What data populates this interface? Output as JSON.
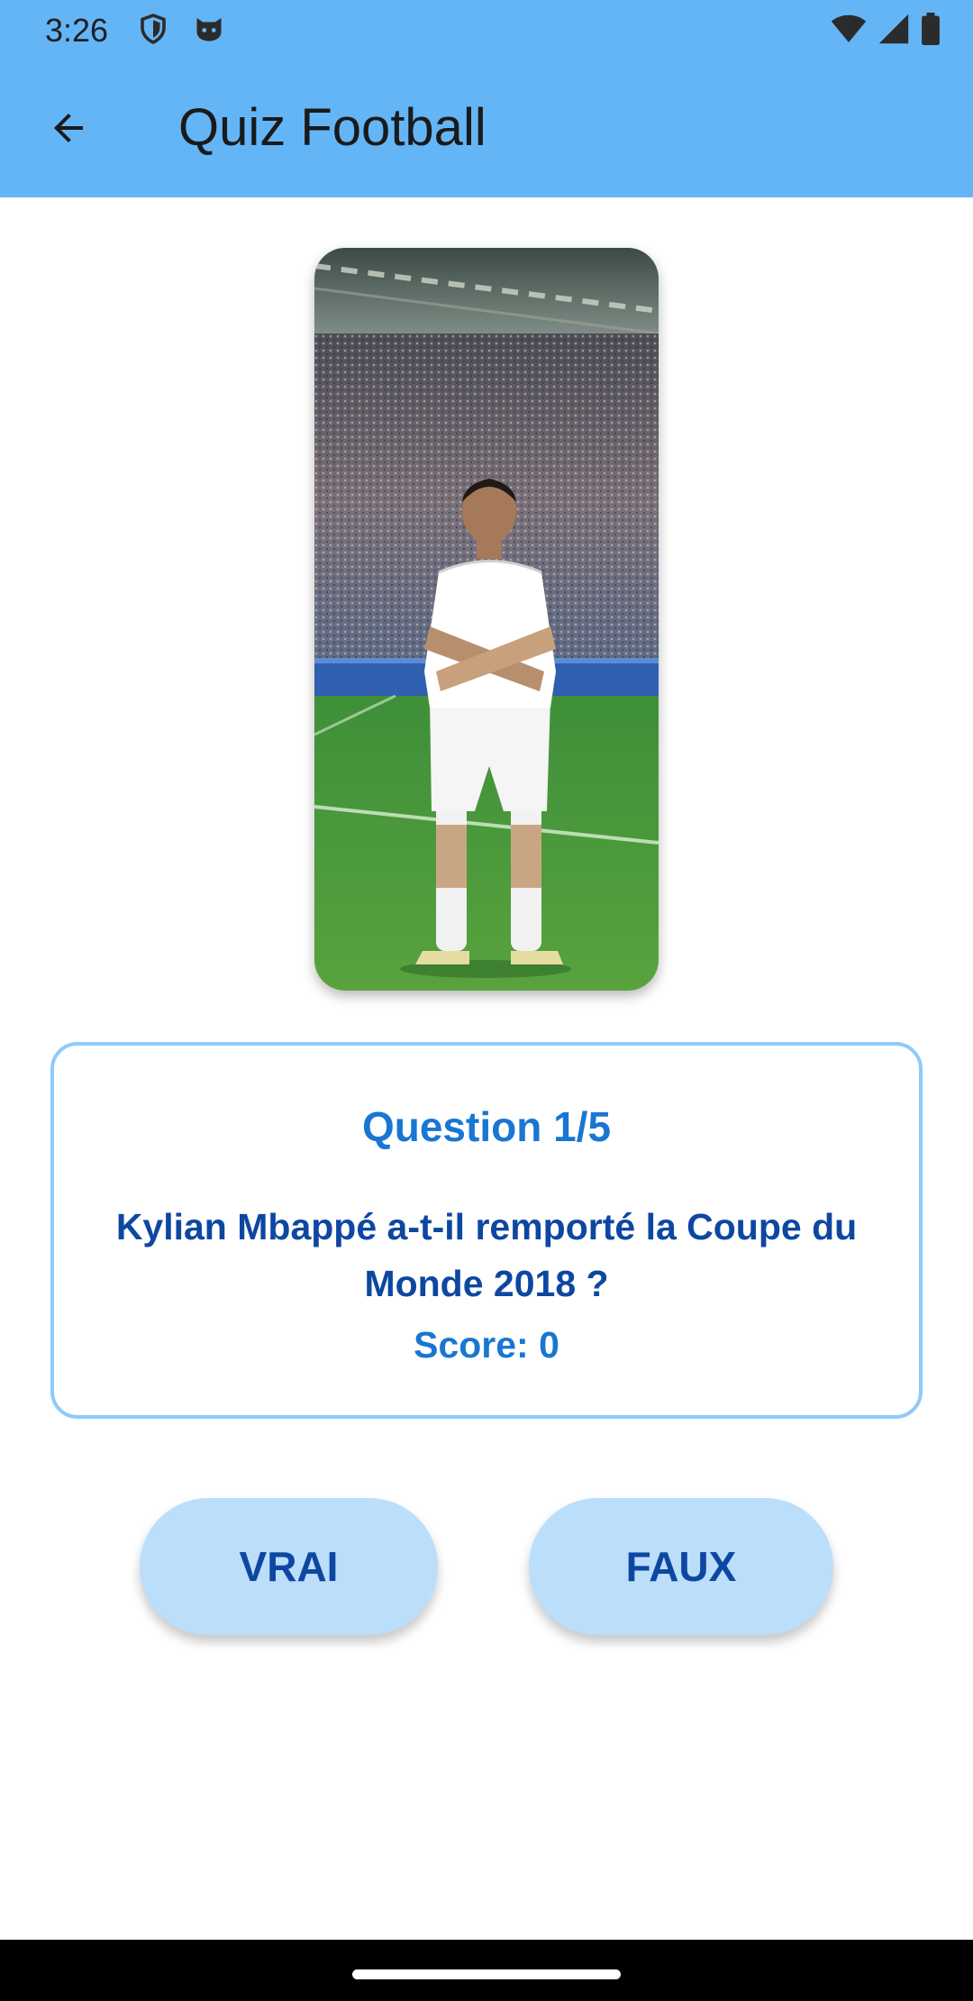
{
  "status_bar": {
    "time": "3:26",
    "left_icons": [
      "shield-icon",
      "cat-face-icon"
    ],
    "right_icons": [
      "wifi-icon",
      "signal-icon",
      "battery-icon"
    ]
  },
  "app_bar": {
    "title": "Quiz Football",
    "back_icon": "arrow-back-icon",
    "color": "#64b5f6"
  },
  "player_image": {
    "subject": "footballer in white kit standing with arms crossed in a stadium"
  },
  "question_card": {
    "counter": "Question 1/5",
    "question": "Kylian Mbappé a-t-il remporté la Coupe du Monde 2018 ?",
    "score": "Score: 0",
    "border_color": "#90caf9"
  },
  "buttons": {
    "true_label": "VRAI",
    "false_label": "FAUX",
    "color": "#bbdefb"
  }
}
